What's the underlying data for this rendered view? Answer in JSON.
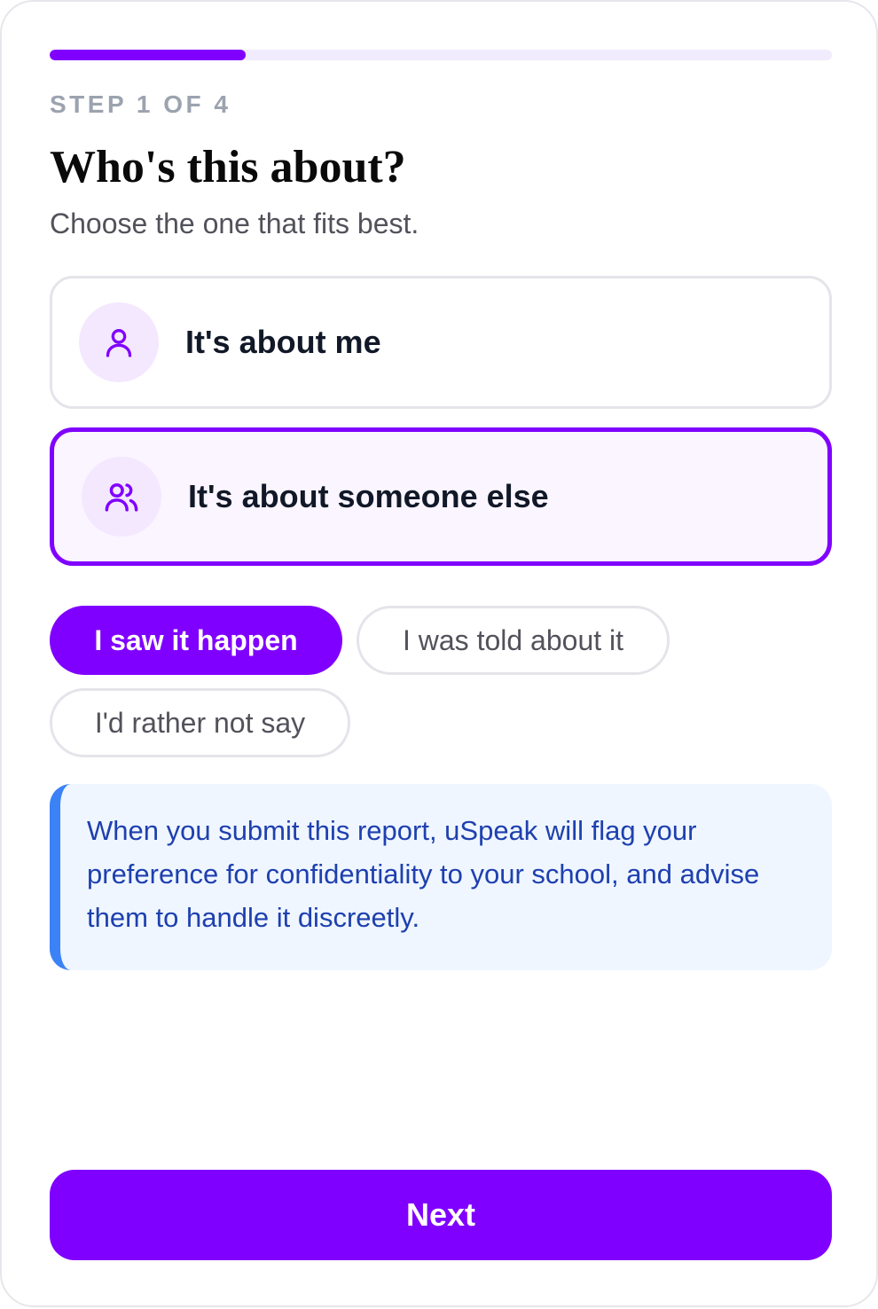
{
  "progress": {
    "step": 1,
    "total": 4,
    "fraction": 0.25
  },
  "header": {
    "step_label": "STEP 1 OF 4",
    "title": "Who's this about?",
    "subtitle": "Choose the one that fits best."
  },
  "options": [
    {
      "label": "It's about me",
      "icon": "person-icon",
      "selected": false
    },
    {
      "label": "It's about someone else",
      "icon": "people-icon",
      "selected": true
    }
  ],
  "chips": [
    {
      "label": "I saw it happen",
      "selected": true
    },
    {
      "label": "I was told about it",
      "selected": false
    },
    {
      "label": "I'd rather not say",
      "selected": false
    }
  ],
  "notice": {
    "text": "When you submit this report, uSpeak will flag your preference for confidentiality to your school, and advise them to handle it discreetly."
  },
  "footer": {
    "next_label": "Next"
  },
  "colors": {
    "accent": "#8000ff",
    "accent_soft": "#f4e8ff",
    "notice_bg": "#eff6ff",
    "notice_bar": "#3b82f6",
    "notice_text": "#1e40af"
  }
}
